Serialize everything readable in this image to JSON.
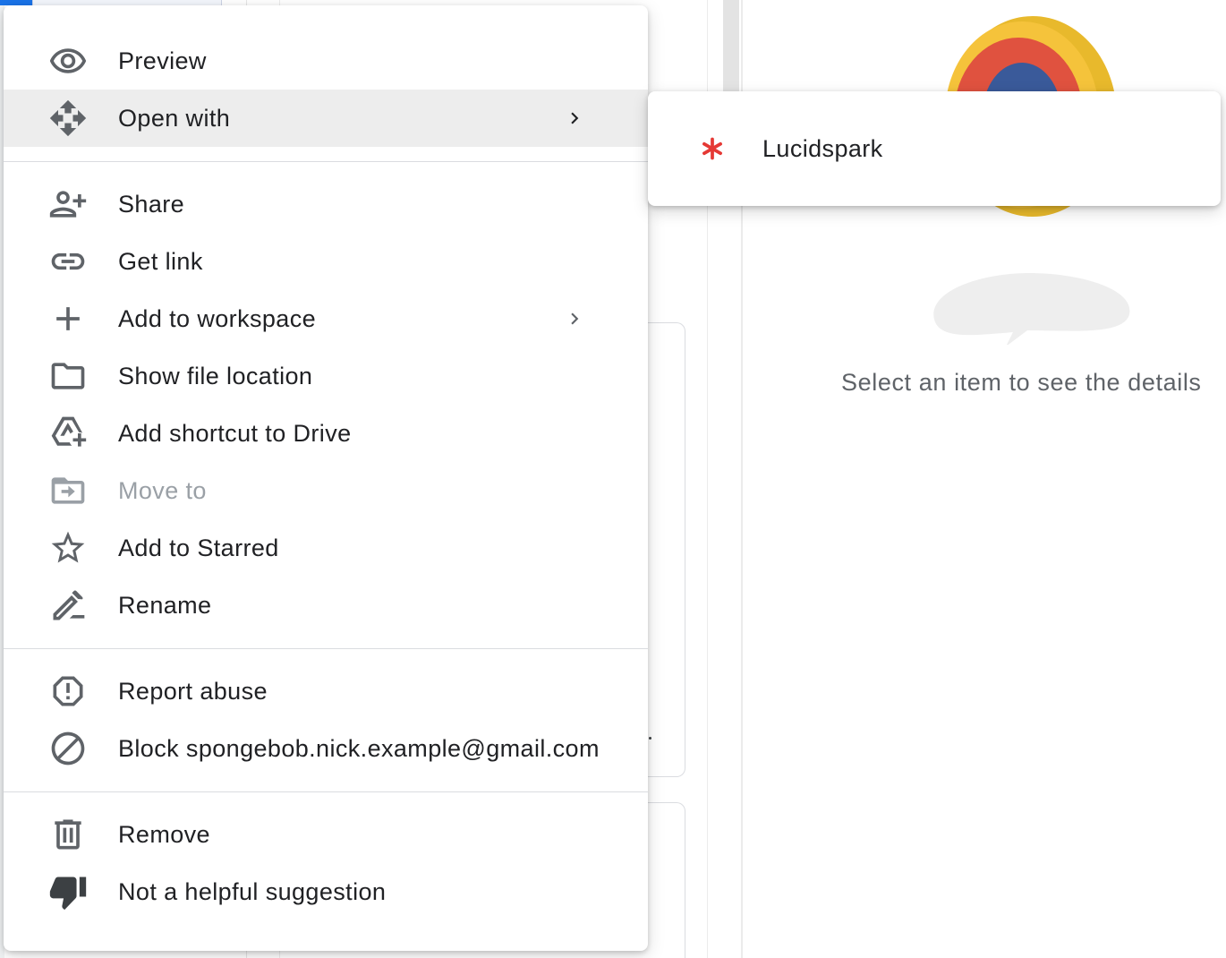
{
  "context_menu": {
    "items": [
      {
        "label": "Preview"
      },
      {
        "label": "Open with"
      },
      {
        "label": "Share"
      },
      {
        "label": "Get link"
      },
      {
        "label": "Add to workspace"
      },
      {
        "label": "Show file location"
      },
      {
        "label": "Add shortcut to Drive"
      },
      {
        "label": "Move to",
        "disabled": true
      },
      {
        "label": "Add to Starred"
      },
      {
        "label": "Rename"
      },
      {
        "label": "Report abuse"
      },
      {
        "label": "Block spongebob.nick.example@gmail.com"
      },
      {
        "label": "Remove"
      },
      {
        "label": "Not a helpful suggestion"
      }
    ]
  },
  "open_with_submenu": {
    "items": [
      {
        "label": "Lucidspark",
        "icon": "lucidspark-asterisk-icon",
        "icon_color": "#e53935"
      }
    ]
  },
  "details_panel": {
    "empty_text": "Select an item to see the details"
  },
  "colors": {
    "icon": "#5f6368",
    "icon_disabled": "#9aa0a6",
    "active_row": "#ededed",
    "separator": "#dadce0"
  }
}
